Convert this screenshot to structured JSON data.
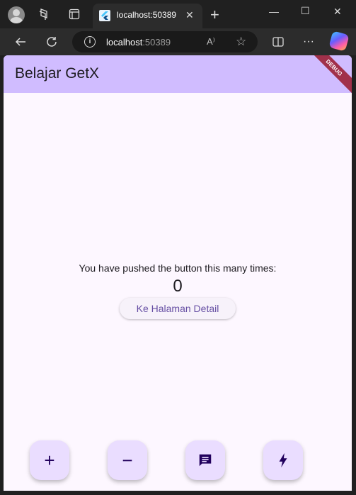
{
  "browser": {
    "tab_title": "localhost:50389",
    "url_host": "localhost",
    "url_port": ":50389",
    "read_aloud_label": "A⁾"
  },
  "app": {
    "title": "Belajar GetX",
    "debug_banner": "DEBUG",
    "pushed_text": "You have pushed the button this many times:",
    "counter": "0",
    "detail_button_label": "Ke Halaman Detail"
  },
  "fabs": [
    {
      "icon": "add-icon",
      "glyph": "+"
    },
    {
      "icon": "remove-icon",
      "glyph": "−"
    },
    {
      "icon": "message-icon",
      "glyph": ""
    },
    {
      "icon": "flash-icon",
      "glyph": ""
    }
  ],
  "colors": {
    "appbar": "#d0bcff",
    "background": "#fdf7ff",
    "fab": "#eaddff",
    "primary": "#6750a4"
  }
}
